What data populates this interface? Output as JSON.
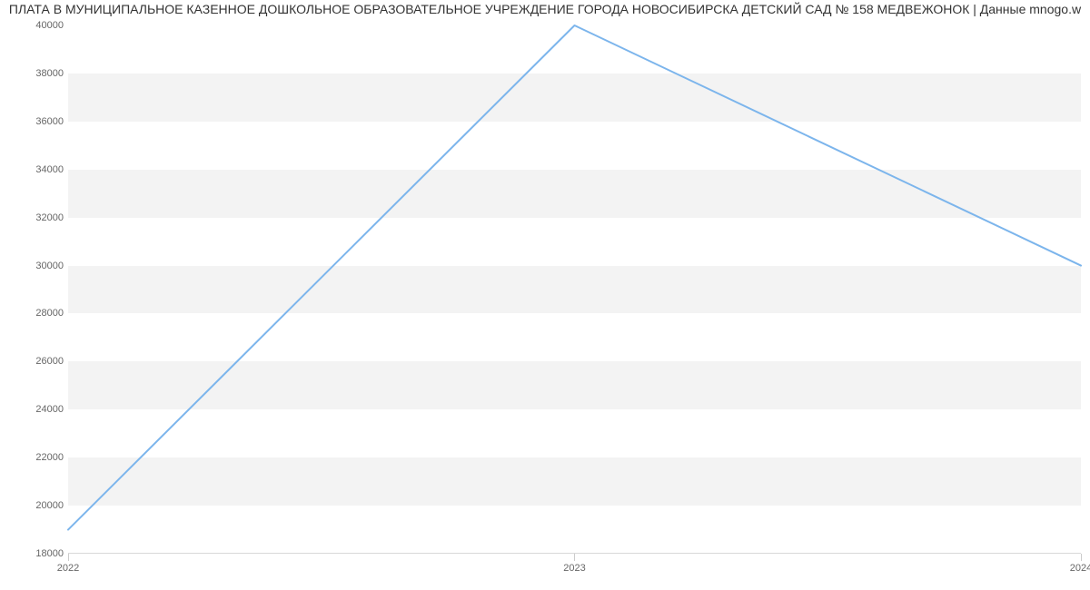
{
  "chart_data": {
    "type": "line",
    "title": "ПЛАТА В МУНИЦИПАЛЬНОЕ КАЗЕННОЕ ДОШКОЛЬНОЕ ОБРАЗОВАТЕЛЬНОЕ УЧРЕЖДЕНИЕ ГОРОДА НОВОСИБИРСКА  ДЕТСКИЙ САД № 158  МЕДВЕЖОНОК | Данные mnogo.w",
    "xlabel": "",
    "ylabel": "",
    "categories": [
      "2022",
      "2023",
      "2024"
    ],
    "values": [
      19000,
      40000,
      30000
    ],
    "ylim": [
      18000,
      40000
    ],
    "y_ticks": [
      18000,
      20000,
      22000,
      24000,
      26000,
      28000,
      30000,
      32000,
      34000,
      36000,
      38000,
      40000
    ],
    "colors": {
      "line": "#7cb5ec",
      "band": "#f3f3f3"
    }
  }
}
